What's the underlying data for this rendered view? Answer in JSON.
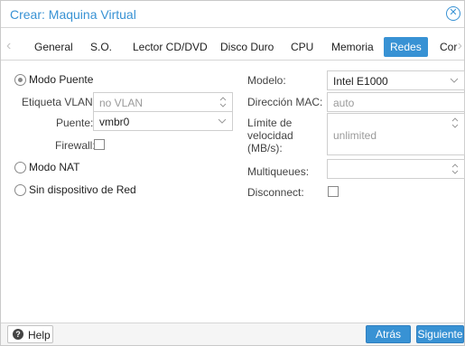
{
  "window": {
    "title": "Crear: Maquina Virtual"
  },
  "tabs": [
    {
      "label": "General",
      "active": false
    },
    {
      "label": "S.O.",
      "active": false
    },
    {
      "label": "Lector CD/DVD",
      "active": false
    },
    {
      "label": "Disco Duro",
      "active": false
    },
    {
      "label": "CPU",
      "active": false
    },
    {
      "label": "Memoria",
      "active": false
    },
    {
      "label": "Redes",
      "active": true
    },
    {
      "label": "Cor",
      "active": false
    }
  ],
  "left": {
    "mode_bridge": {
      "label": "Modo Puente",
      "checked": true
    },
    "vlan": {
      "label": "Etiqueta VLAN:",
      "value": "no VLAN"
    },
    "bridge": {
      "label": "Puente:",
      "value": "vmbr0"
    },
    "firewall": {
      "label": "Firewall:",
      "checked": false
    },
    "mode_nat": {
      "label": "Modo NAT",
      "checked": false
    },
    "no_device": {
      "label": "Sin dispositivo de Red",
      "checked": false
    }
  },
  "right": {
    "model": {
      "label": "Modelo:",
      "value": "Intel E1000"
    },
    "mac": {
      "label": "Dirección MAC:",
      "value": "auto"
    },
    "rate_limit": {
      "label_line1": "Límite de",
      "label_line2": "velocidad",
      "label_line3": "(MB/s):",
      "value": "unlimited"
    },
    "multiqueue": {
      "label": "Multiqueues:",
      "value": ""
    },
    "disconnect": {
      "label": "Disconnect:",
      "checked": false
    }
  },
  "footer": {
    "help_label": "Help",
    "back_label": "Atrás",
    "next_label": "Siguiente"
  },
  "colors": {
    "accent": "#3892d4",
    "border": "#cfcfcf"
  }
}
